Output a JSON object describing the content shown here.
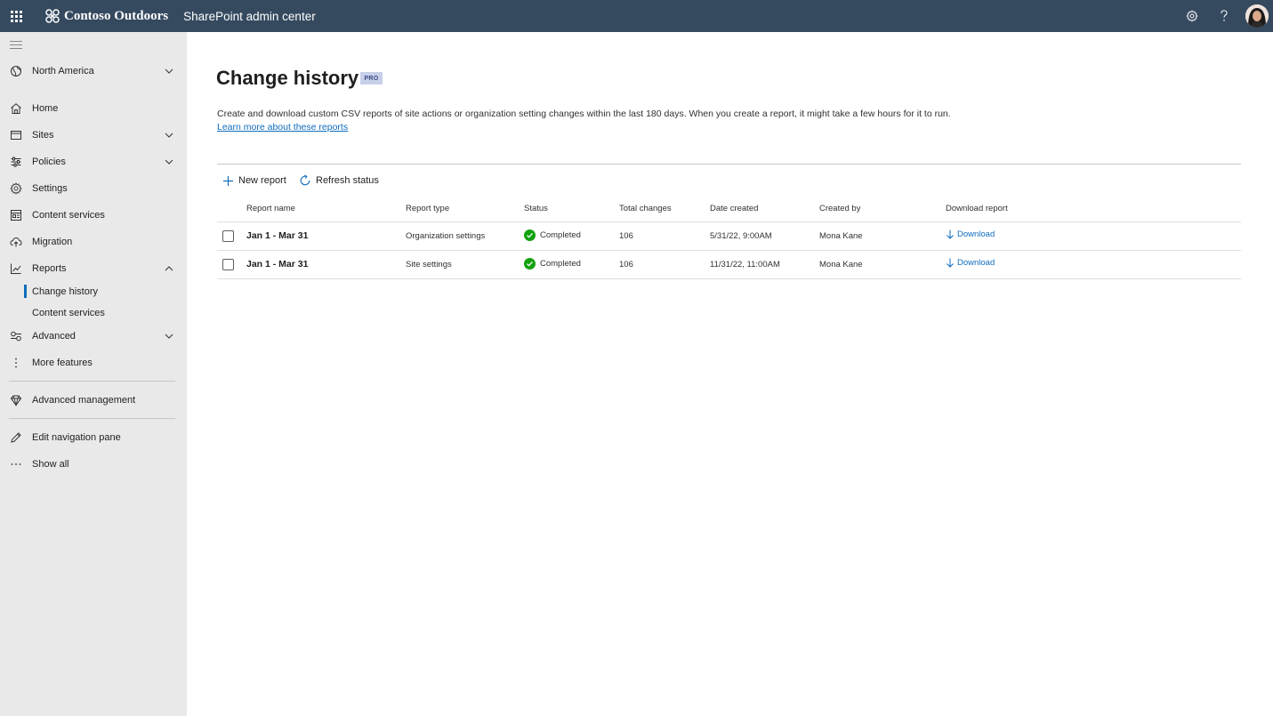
{
  "topbar": {
    "brand": "Contoso Outdoors",
    "app_name": "SharePoint admin center",
    "icons": [
      "waffle-icon",
      "settings-icon",
      "help-icon",
      "avatar"
    ]
  },
  "sidebar": {
    "region": "North America",
    "items": [
      {
        "label": "Home",
        "icon": "home-icon"
      },
      {
        "label": "Sites",
        "icon": "sites-icon",
        "expandable": true
      },
      {
        "label": "Policies",
        "icon": "policies-icon",
        "expandable": true
      },
      {
        "label": "Settings",
        "icon": "settings-icon"
      },
      {
        "label": "Content services",
        "icon": "content-services-icon"
      },
      {
        "label": "Migration",
        "icon": "migration-icon"
      },
      {
        "label": "Reports",
        "icon": "reports-icon",
        "expanded": true
      },
      {
        "label": "Advanced",
        "icon": "advanced-icon",
        "expandable": true
      },
      {
        "label": "More features",
        "icon": "more-features-icon"
      }
    ],
    "report_subitems": [
      "Change history",
      "Content services"
    ],
    "advanced_management": "Advanced management",
    "edit_nav": "Edit navigation pane",
    "show_all": "Show all"
  },
  "main": {
    "title": "Change history",
    "badge": "PRO",
    "description": "Create and download custom CSV reports of site actions or organization setting changes within the last 180 days. When you create a report, it might take a few hours for it to run.",
    "learn_more": "Learn more about these reports",
    "commands": {
      "new_report": "New report",
      "refresh_status": "Refresh status"
    },
    "columns": [
      "Report name",
      "Report type",
      "Status",
      "Total changes",
      "Date created",
      "Created by",
      "Download report"
    ],
    "rows": [
      {
        "name": "Jan 1 - Mar 31",
        "type": "Organization settings",
        "status": "Completed",
        "total": "106",
        "date": "5/31/22, 9:00AM",
        "by": "Mona Kane",
        "download": "Download"
      },
      {
        "name": "Jan 1 - Mar 31",
        "type": "Site settings",
        "status": "Completed",
        "total": "106",
        "date": "11/31/22, 11:00AM",
        "by": "Mona Kane",
        "download": "Download"
      }
    ]
  },
  "colors": {
    "topbar": "#354a5f",
    "sidebar": "#e9e9e9",
    "accent": "#0f6cbd",
    "success": "#13a10e",
    "badge_bg": "#c7d0e9"
  }
}
